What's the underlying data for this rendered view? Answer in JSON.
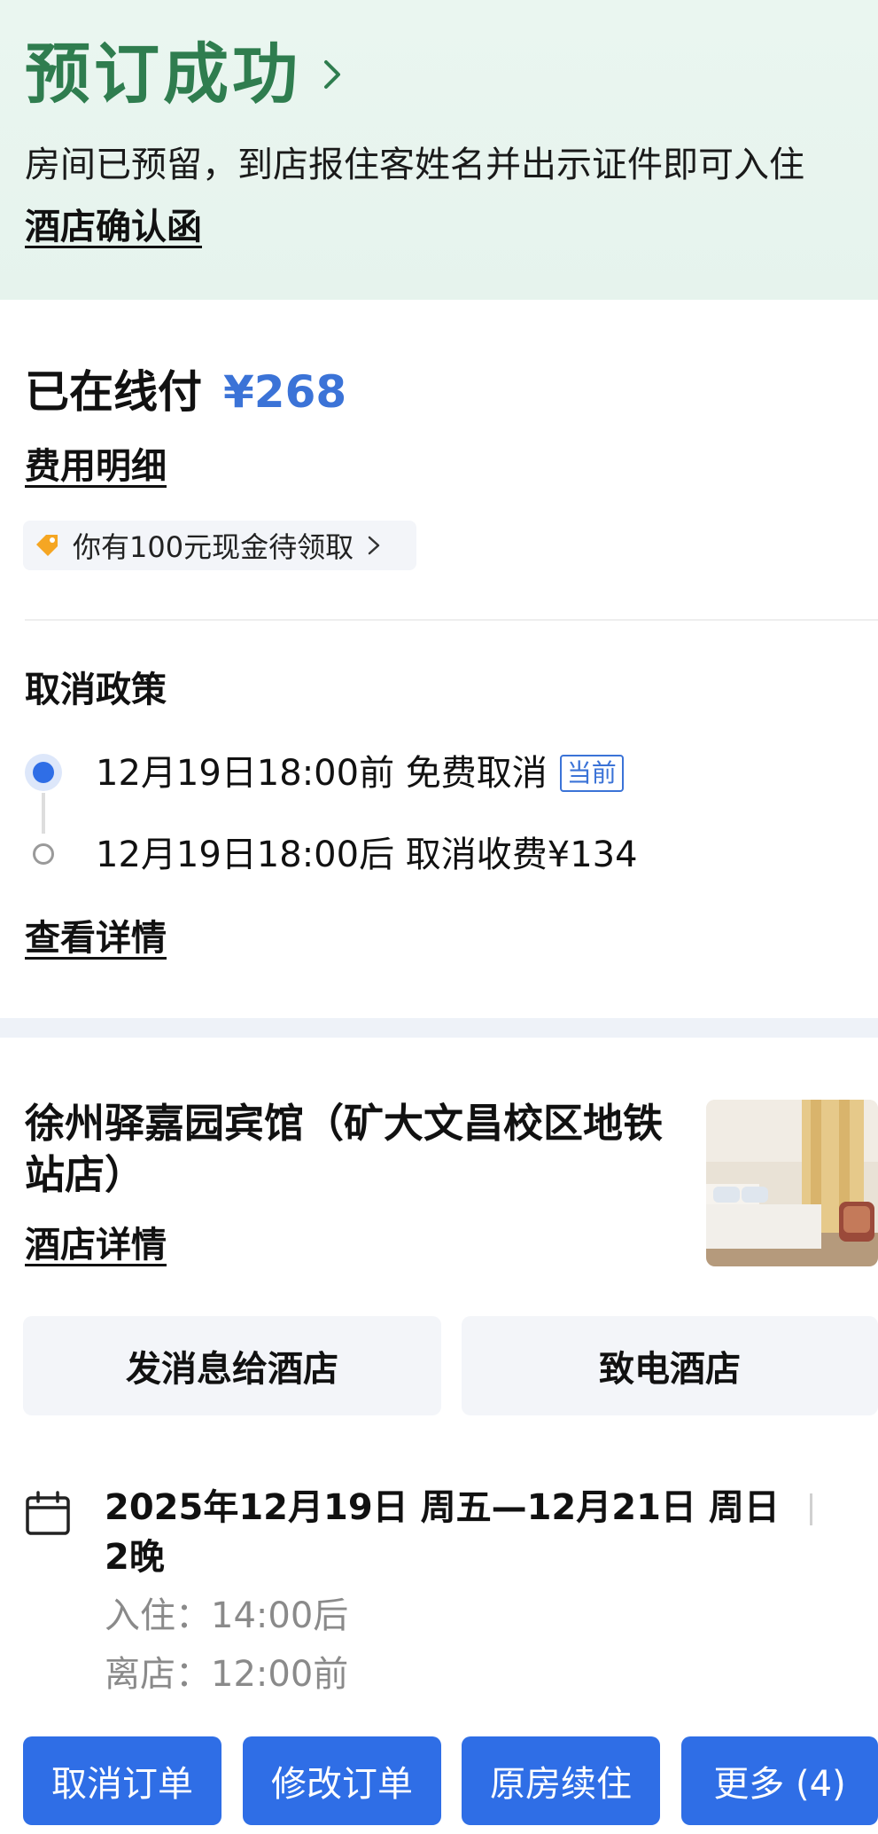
{
  "header": {
    "title": "预订成功",
    "description": "房间已预留，到店报住客姓名并出示证件即可入住",
    "confirmation_link": "酒店确认函"
  },
  "payment": {
    "paid_label": "已在线付",
    "paid_amount": "¥268",
    "fee_detail_link": "费用明细",
    "cash_promo": "你有100元现金待领取"
  },
  "cancellation": {
    "title": "取消政策",
    "policies": [
      {
        "text": "12月19日18:00前 免费取消",
        "badge": "当前",
        "active": true
      },
      {
        "text": "12月19日18:00后 取消收费¥134",
        "badge": "",
        "active": false
      }
    ],
    "detail_link": "查看详情"
  },
  "hotel": {
    "name": "徐州驿嘉园宾馆（矿大文昌校区地铁站店）",
    "detail_link": "酒店详情",
    "message_button": "发消息给酒店",
    "call_button": "致电酒店"
  },
  "stay": {
    "dates": "2025年12月19日 周五—12月21日 周日",
    "nights": "2晚",
    "checkin": "入住：14:00后",
    "checkout": "离店：12:00前"
  },
  "actions": [
    "取消订单",
    "修改订单",
    "原房续住",
    "更多 (4)"
  ],
  "colors": {
    "accent_blue": "#2f6ee6",
    "price_blue": "#3b73d7",
    "success_green": "#2f7d4f",
    "hero_bg": "#e6f3ed"
  }
}
